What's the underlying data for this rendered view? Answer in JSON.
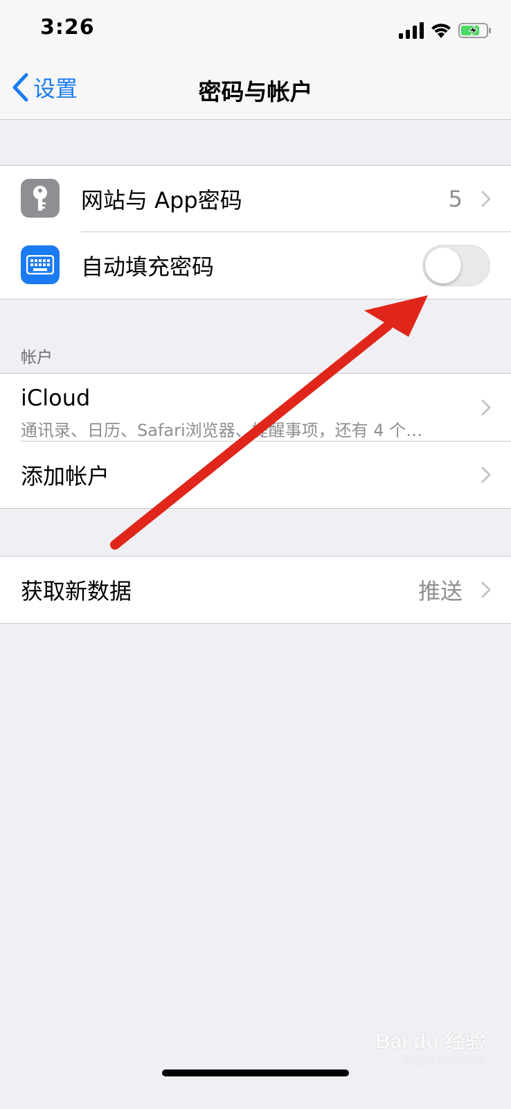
{
  "status_bar": {
    "time": "3:26",
    "icons": [
      "cellular-signal-icon",
      "wifi-icon",
      "battery-charging-icon"
    ],
    "battery_color": "#4cd964"
  },
  "nav": {
    "back_label": "设置",
    "title": "密码与帐户",
    "accent_color": "#1a7bf2"
  },
  "passwords_group": {
    "items": [
      {
        "label": "网站与 App密码",
        "value": "5",
        "icon": "key-icon",
        "icon_color": "#8e8e93"
      },
      {
        "label": "自动填充密码",
        "icon": "keyboard-icon",
        "icon_color": "#1a7bf2",
        "toggle_on": false
      }
    ]
  },
  "accounts": {
    "header": "帐户",
    "items": [
      {
        "title": "iCloud",
        "subtitle": "通讯录、日历、Safari浏览器、提醒事项，还有 4 个…"
      },
      {
        "label": "添加帐户"
      }
    ]
  },
  "fetch": {
    "label": "获取新数据",
    "value": "推送"
  },
  "watermark": {
    "main": "Bai du 经验",
    "sub": "jingyan.baidu.com"
  }
}
